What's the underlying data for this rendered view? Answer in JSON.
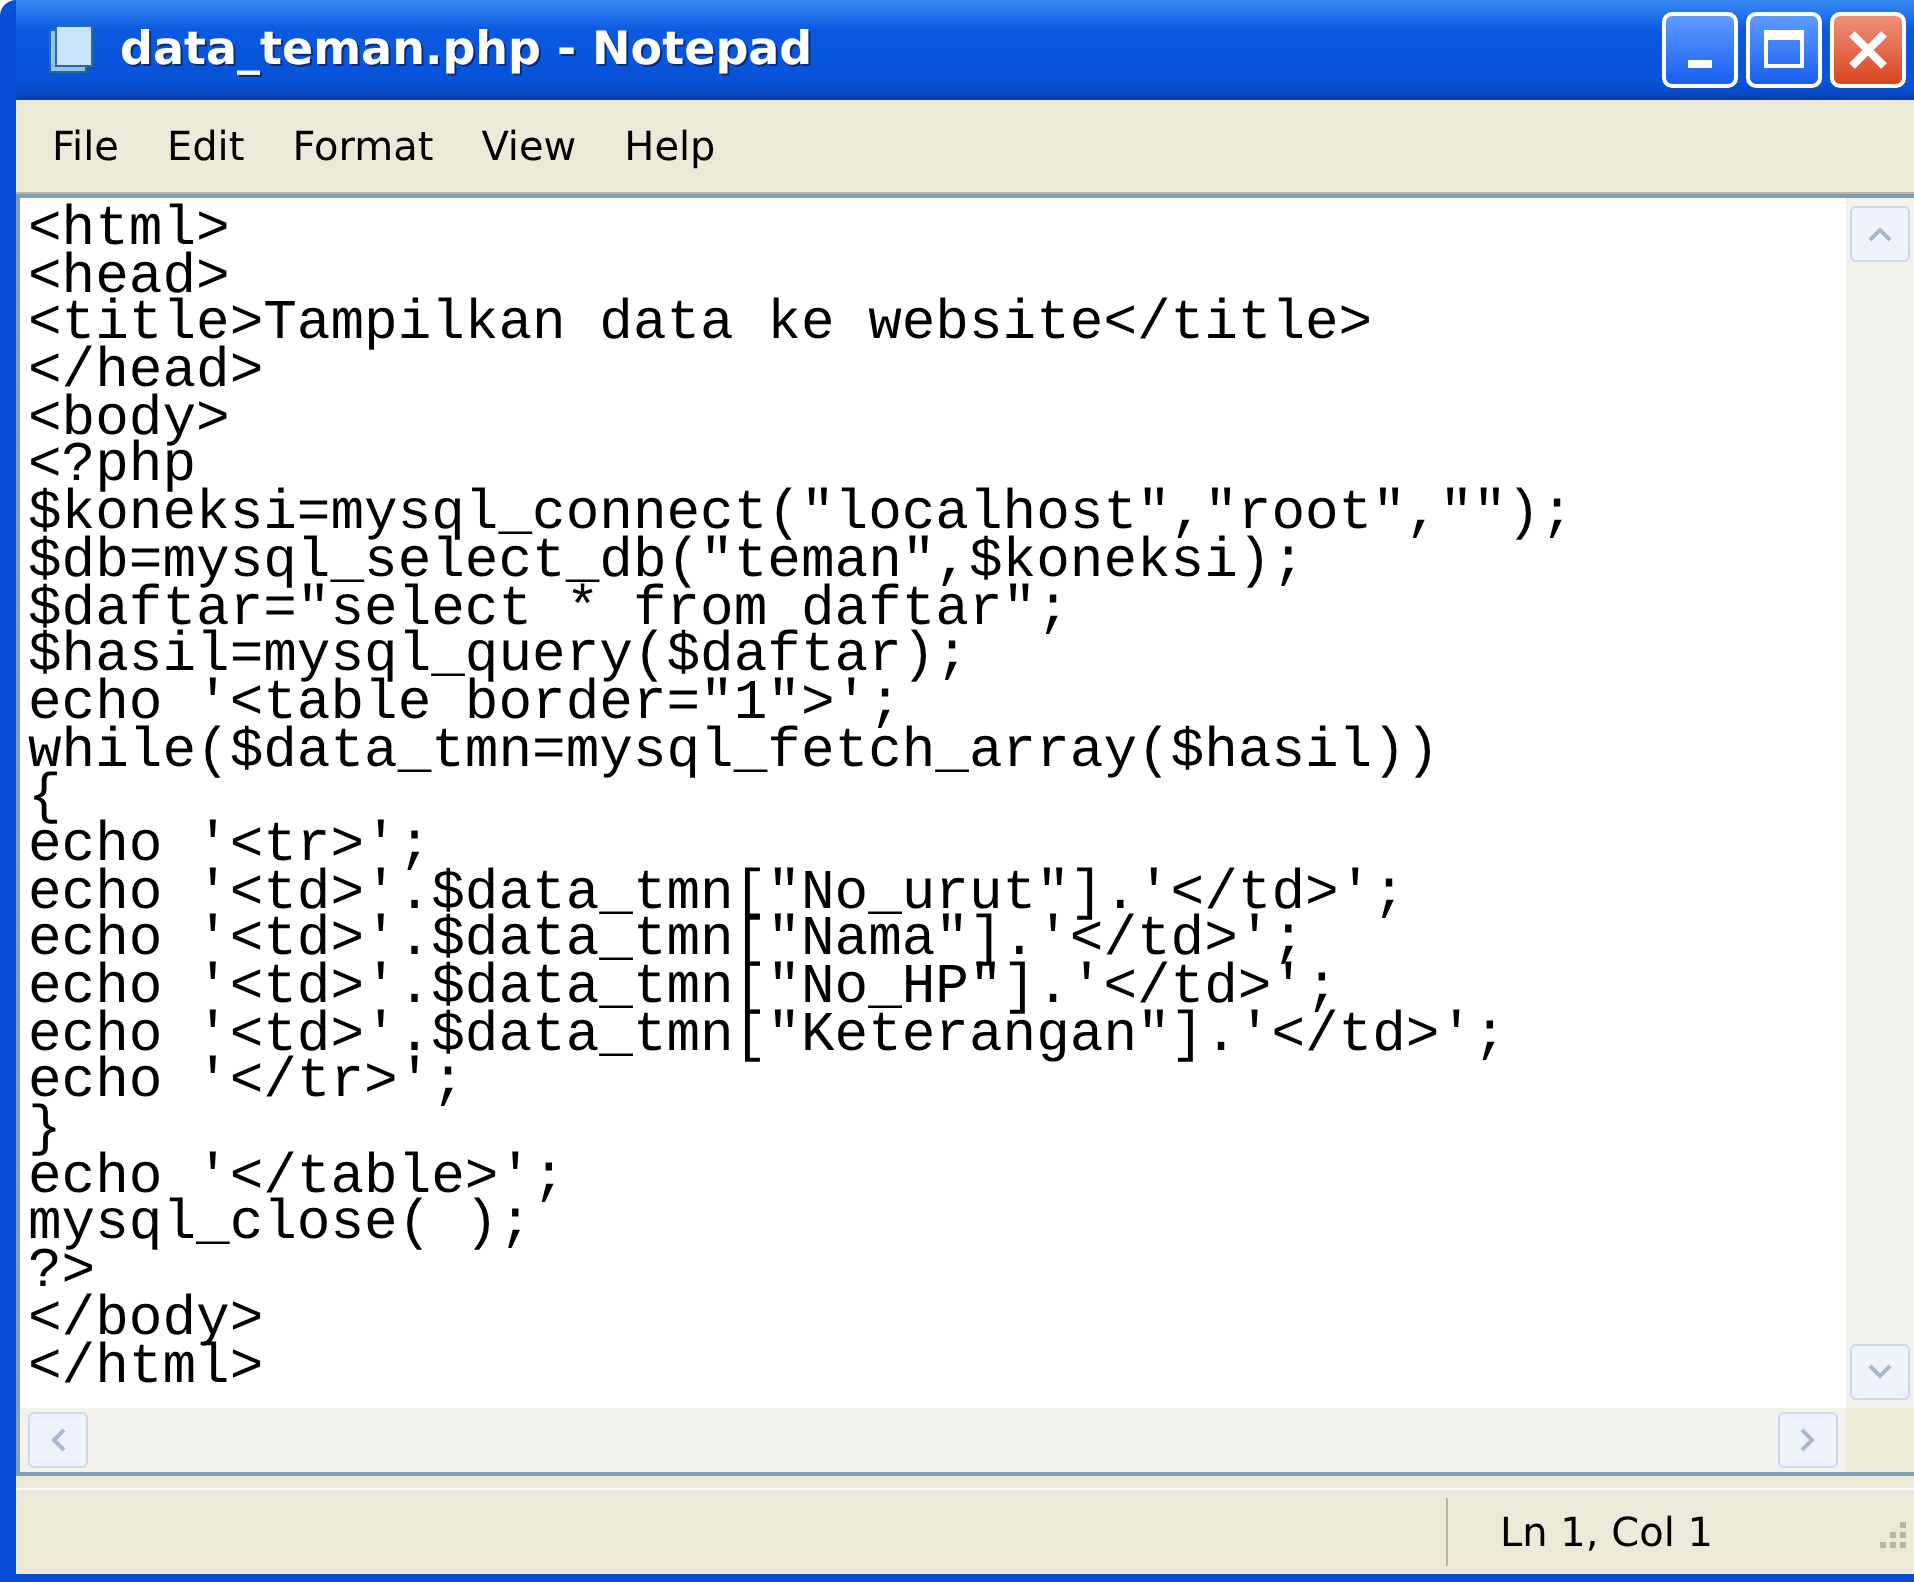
{
  "window": {
    "title": "data_teman.php - Notepad"
  },
  "menu": [
    {
      "label": "File"
    },
    {
      "label": "Edit"
    },
    {
      "label": "Format"
    },
    {
      "label": "View"
    },
    {
      "label": "Help"
    }
  ],
  "editor": {
    "lines": [
      "<html>",
      "<head>",
      "<title>Tampilkan data ke website</title>",
      "</head>",
      "<body>",
      "<?php",
      "$koneksi=mysql_connect(\"localhost\",\"root\",\"\");",
      "$db=mysql_select_db(\"teman\",$koneksi);",
      "$daftar=\"select * from daftar\";",
      "$hasil=mysql_query($daftar);",
      "echo '<table border=\"1\">';",
      "while($data_tmn=mysql_fetch_array($hasil))",
      "{",
      "echo '<tr>';",
      "echo '<td>'.$data_tmn[\"No_urut\"].'</td>';",
      "echo '<td>'.$data_tmn[\"Nama\"].'</td>';",
      "echo '<td>'.$data_tmn[\"No_HP\"].'</td>';",
      "echo '<td>'.$data_tmn[\"Keterangan\"].'</td>';",
      "echo '</tr>';",
      "}",
      "echo '</table>';",
      "mysql_close( );",
      "?>",
      "</body>",
      "</html>"
    ]
  },
  "status_bar": {
    "position": "Ln 1, Col 1"
  }
}
